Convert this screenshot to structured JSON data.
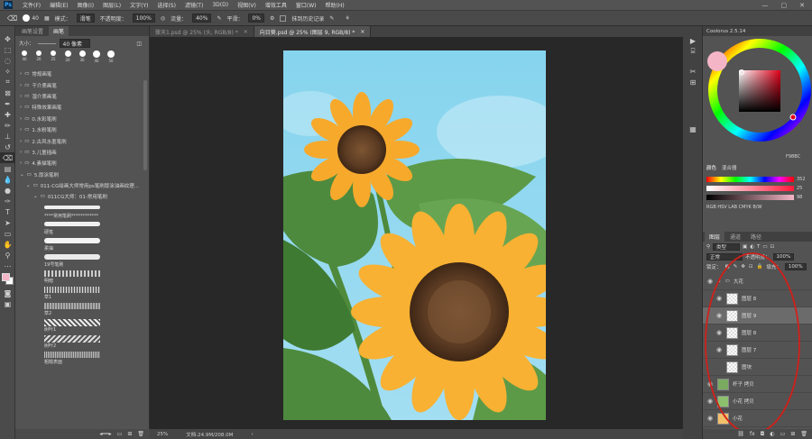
{
  "menubar": {
    "logo": "Ps",
    "items": [
      "文件(F)",
      "编辑(E)",
      "图像(I)",
      "图层(L)",
      "文字(Y)",
      "选择(S)",
      "滤镜(T)",
      "3D(D)",
      "视图(V)",
      "增效工具",
      "窗口(W)",
      "帮助(H)"
    ],
    "win_controls": [
      "—",
      "▢",
      "✕"
    ]
  },
  "options": {
    "size": "40",
    "mode_label": "模式：",
    "mode_value": "滑笔",
    "opacity_label": "不透明度：",
    "opacity_value": "100%",
    "flow_label": "流量：",
    "flow_value": "40%",
    "smooth_label": "平滑：",
    "smooth_value": "0%",
    "history_label": "抹到历史记录"
  },
  "left_panel": {
    "tabs": [
      "画笔设置",
      "画笔"
    ],
    "size_label": "大小：",
    "size_value": "40 像素",
    "presets": [
      "40",
      "26",
      "25",
      "20",
      "30",
      "40",
      "50"
    ],
    "folders": [
      "常规画笔",
      "干介质画笔",
      "湿介质画笔",
      "特殊效果画笔",
      "0.水彩笔刷",
      "1.水粉笔刷",
      "2.古风水墨笔刷",
      "3.儿童插画",
      "4.素描笔刷",
      "5.厚涂笔刷",
      "011-CG绘画大师常用ps笔刷厚涂油画纹理...",
      "011CG大师：01-常用笔刷"
    ],
    "brushes": [
      "****常用笔刷************",
      "硬笔",
      "柔抽",
      "19号笔刷",
      "明暗",
      "草1",
      "草2",
      "树叶1",
      "树叶2",
      "粗糙表面"
    ]
  },
  "doc_tabs": [
    "骤天1.psd @ 25% (头, RGB/8) *",
    "向日葵.psd @ 25% (图层 9, RGB/8) *"
  ],
  "status": {
    "zoom": "25%",
    "doc": "文档:24.9M/208.0M"
  },
  "color_panel": {
    "title": "Coolorus 2.5.14",
    "hex": "F98BC",
    "tabs": [
      "颜色",
      "混合器"
    ],
    "sliders": [
      {
        "value": "352"
      },
      {
        "value": "25"
      },
      {
        "value": "98"
      }
    ],
    "modes": "RGB HSV LAB CMYK B/W"
  },
  "layers_panel": {
    "tabs": [
      "图层",
      "通道",
      "路径"
    ],
    "filter": "类型",
    "blend": "正常",
    "opacity_label": "不透明度：",
    "opacity": "100%",
    "lock_label": "锁定：",
    "fill_label": "填充：",
    "fill": "100%",
    "layers": [
      {
        "name": "大花",
        "group": true
      },
      {
        "name": "图层 8"
      },
      {
        "name": "图层 9",
        "selected": true
      },
      {
        "name": "图层 8"
      },
      {
        "name": "图层 7"
      },
      {
        "name": "图块"
      },
      {
        "name": "杆子 拷贝"
      },
      {
        "name": "小花 拷贝"
      },
      {
        "name": "小花"
      }
    ]
  },
  "colors": {
    "accent": "#31a8ff",
    "fg": "#f4b5c6",
    "bg": "#ffffff",
    "sky": "#8fd8ef",
    "petal": "#f7a92c",
    "center": "#5a3a22",
    "leaf": "#4e8a3e"
  }
}
